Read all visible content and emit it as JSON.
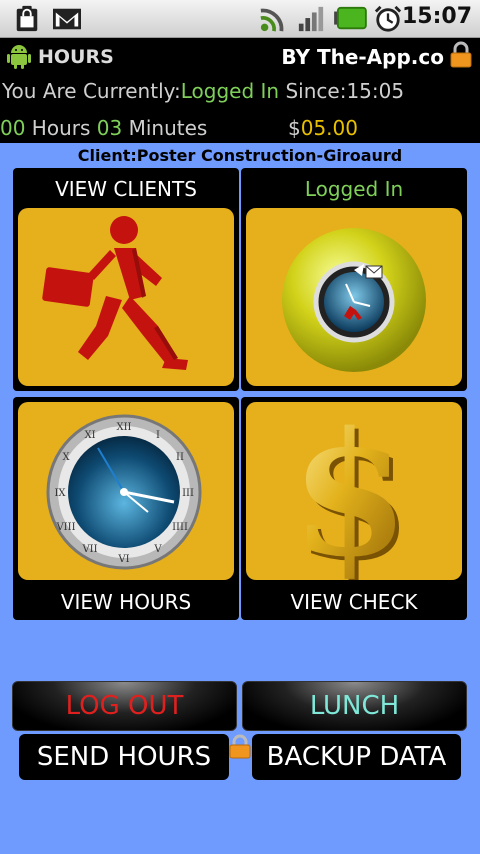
{
  "status_bar": {
    "time": "15:07",
    "icons": [
      "clipboard-icon",
      "gmail-icon",
      "wifi-icon",
      "signal-icon",
      "battery-icon",
      "alarm-icon"
    ]
  },
  "header": {
    "title": "HOURS",
    "byline": "BY The-App.co"
  },
  "info": {
    "currently_label": "You Are Currently:",
    "status": "Logged In",
    "since_label": " Since:",
    "since_time": "15:05",
    "hours_value": "00",
    "hours_label": " Hours ",
    "minutes_value": "03",
    "minutes_label": " Minutes",
    "currency": "$",
    "amount": "05.00"
  },
  "client_line": "Client:Poster Construction-Giroaurd",
  "tiles": [
    {
      "label": "VIEW CLIENTS",
      "icon": "walking-man-icon"
    },
    {
      "label": "Logged In",
      "icon": "clock-ball-icon"
    },
    {
      "label": "VIEW HOURS",
      "icon": "clock-icon"
    },
    {
      "label": "VIEW CHECK",
      "icon": "dollar-icon"
    }
  ],
  "buttons": {
    "logout": "LOG  OUT",
    "lunch": "LUNCH",
    "send_hours": "SEND HOURS",
    "backup": "BACKUP  DATA"
  },
  "colors": {
    "background": "#6f9bff",
    "tile_art": "#e6b01c",
    "status_green": "#7fd05a",
    "amount_gold": "#e9c000",
    "logout_red": "#e0201e",
    "lunch_cyan": "#7fe8d8"
  }
}
